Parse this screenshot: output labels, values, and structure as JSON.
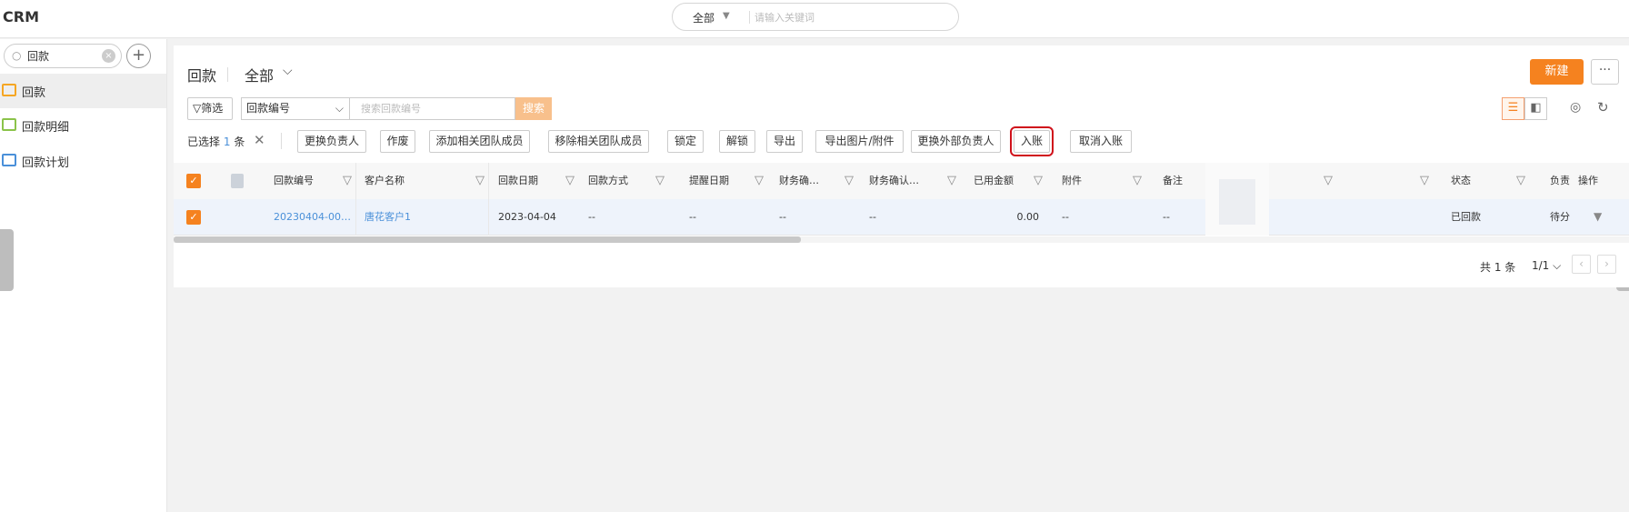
{
  "app": {
    "title": "CRM"
  },
  "global_search": {
    "scope": "全部",
    "placeholder": "请输入关键词"
  },
  "sidebar": {
    "search_value": "回款",
    "items": [
      {
        "label": "回款",
        "icon": "payment-icon",
        "color": "#f5a623",
        "active": true
      },
      {
        "label": "回款明细",
        "icon": "payment-detail-icon",
        "color": "#8bc34a",
        "active": false
      },
      {
        "label": "回款计划",
        "icon": "payment-plan-icon",
        "color": "#4a90d9",
        "active": false
      }
    ]
  },
  "header": {
    "title": "回款",
    "view": "全部",
    "new_label": "新建",
    "more_label": "···"
  },
  "filter": {
    "filter_label": "筛选",
    "field": "回款编号",
    "search_placeholder": "搜索回款编号",
    "search_label": "搜索"
  },
  "selection": {
    "prefix": "已选择",
    "count": "1",
    "suffix": "条"
  },
  "actions": [
    "更换负责人",
    "作废",
    "添加相关团队成员",
    "移除相关团队成员",
    "锁定",
    "解锁",
    "导出",
    "导出图片/附件",
    "更换外部负责人",
    "入账",
    "取消入账"
  ],
  "table": {
    "columns": [
      "回款编号",
      "客户名称",
      "回款日期",
      "回款方式",
      "提醒日期",
      "财务确…",
      "财务确认…",
      "已用金额",
      "附件",
      "备注",
      "状态",
      "负责",
      "操作"
    ],
    "rows": [
      {
        "payment_no": "20230404-00…",
        "customer": "唐花客户1",
        "payment_date": "2023-04-04",
        "payment_method": "--",
        "remind_date": "--",
        "finance_confirm1": "--",
        "finance_confirm2": "--",
        "used_amount": "0.00",
        "attachment": "--",
        "remark": "--",
        "status": "已回款",
        "owner": "待分"
      }
    ]
  },
  "pager": {
    "total": "共 1 条",
    "page": "1/1"
  },
  "colors": {
    "accent": "#f5821f",
    "link": "#4a90d9",
    "highlight": "#d0111b"
  }
}
